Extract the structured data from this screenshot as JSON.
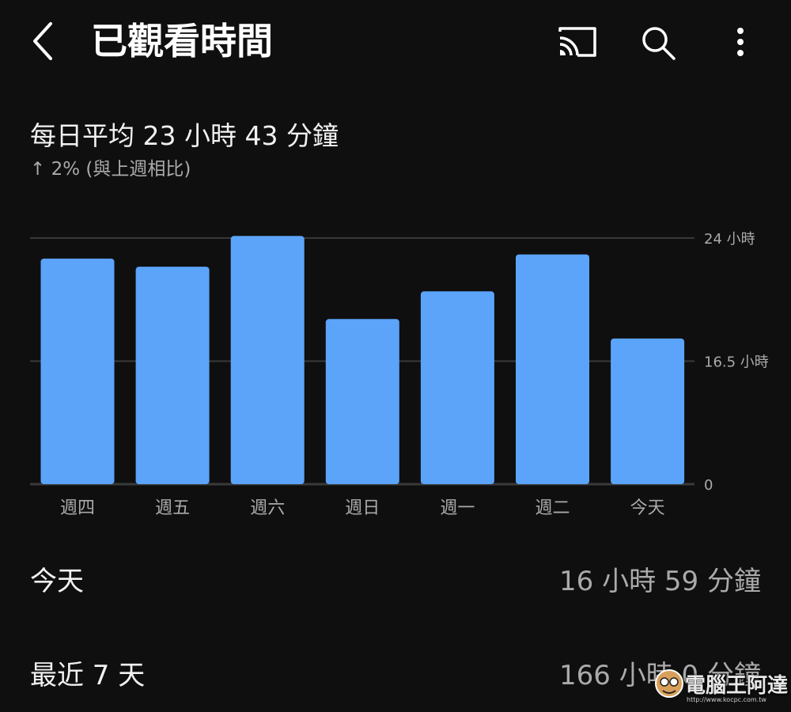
{
  "header": {
    "title": "已觀看時間",
    "back_icon": "back-arrow-icon",
    "cast_icon": "cast-icon",
    "search_icon": "search-icon",
    "more_icon": "more-vert-icon"
  },
  "summary": {
    "daily_average": "每日平均 23 小時 43 分鐘",
    "change": "↑ 2% (與上週相比)"
  },
  "chart_data": {
    "type": "bar",
    "categories": [
      "週四",
      "週五",
      "週六",
      "週日",
      "週一",
      "週二",
      "今天"
    ],
    "values": [
      22.0,
      21.2,
      24.2,
      16.1,
      18.8,
      22.4,
      14.2
    ],
    "ylim": [
      0,
      24.3
    ],
    "y_ticks": [
      "24 小時",
      "16.5 小時",
      "0"
    ],
    "y_tick_values": [
      24,
      12,
      0
    ],
    "bar_color": "#5ba4fa",
    "gridlines": true,
    "grid_color": "#3a3a3a",
    "label_color": "#aaaaaa"
  },
  "stats": [
    {
      "label": "今天",
      "value": "16 小時 59 分鐘"
    },
    {
      "label": "最近 7 天",
      "value": "166 小時 0 分鐘"
    }
  ],
  "watermark": {
    "text": "電腦王阿達",
    "url": "http://www.kocpc.com.tw"
  }
}
